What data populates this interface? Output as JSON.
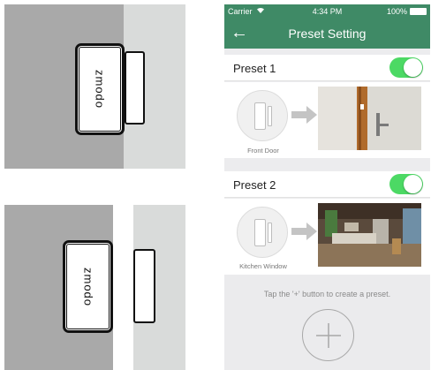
{
  "illustrations": {
    "top": {
      "brand": "zmodo"
    },
    "bottom": {
      "brand": "zmodo"
    }
  },
  "phone": {
    "status_bar": {
      "carrier": "Carrier",
      "wifi_icon": "wifi-icon",
      "time": "4:34 PM",
      "battery": "100%",
      "battery_icon": "battery-icon"
    },
    "nav": {
      "back_icon": "back-arrow-icon",
      "back_glyph": "←",
      "title": "Preset Setting"
    },
    "presets": [
      {
        "name": "Preset 1",
        "enabled": true,
        "location": "Front Door",
        "sensor_icon": "door-sensor-icon",
        "arrow_icon": "arrow-right-icon",
        "snapshot": "front-door-photo"
      },
      {
        "name": "Preset 2",
        "enabled": true,
        "location": "Kitchen Window",
        "sensor_icon": "door-sensor-icon",
        "arrow_icon": "arrow-right-icon",
        "snapshot": "kitchen-photo"
      }
    ],
    "empty_hint": "Tap the '+' button to create a preset.",
    "add_icon": "plus-icon"
  },
  "colors": {
    "accent": "#3f8a66",
    "toggle_on": "#4cd964",
    "background": "#ececee"
  }
}
